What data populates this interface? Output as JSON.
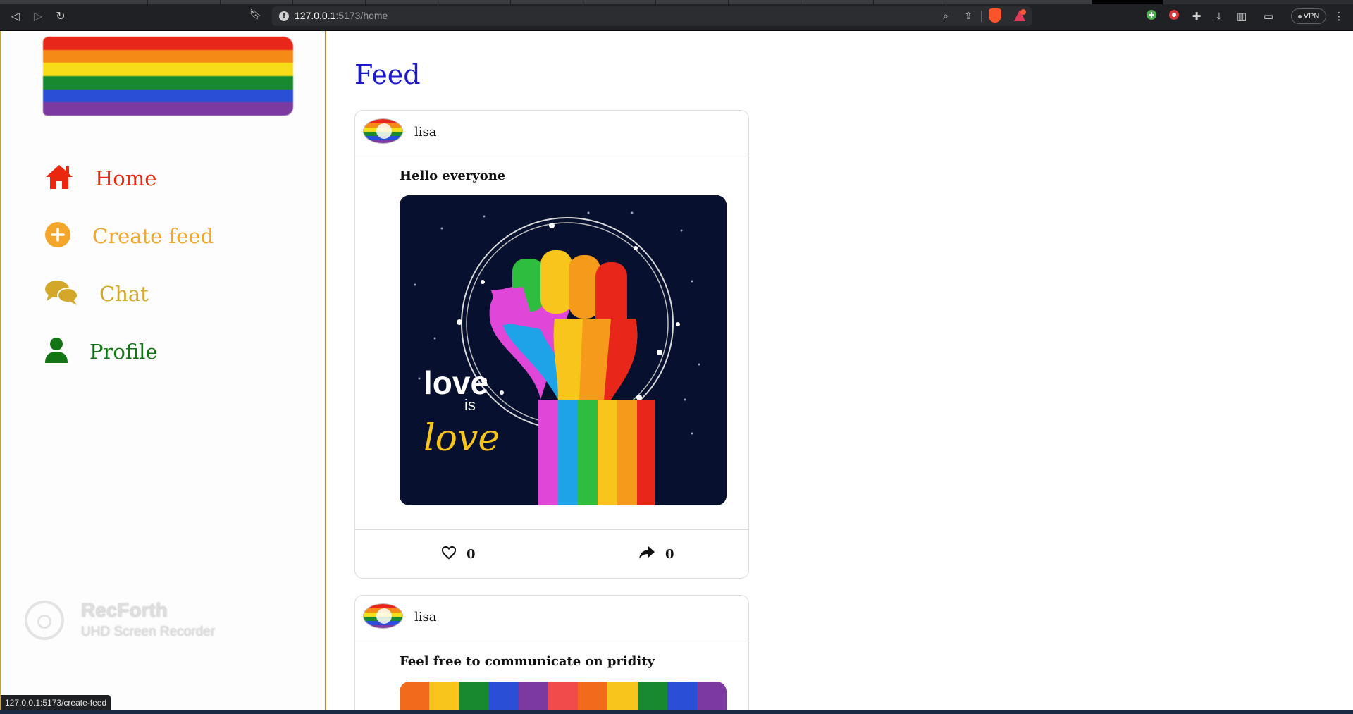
{
  "browser": {
    "url_host": "127.0.0.1",
    "url_path": ":5173/home",
    "vpn_label": "VPN",
    "status_url": "127.0.0.1:5173/create-feed"
  },
  "sidebar": {
    "nav": [
      {
        "label": "Home",
        "icon": "home-icon",
        "color": "#e8270e"
      },
      {
        "label": "Create feed",
        "icon": "plus-circle-icon",
        "color": "#f4a62a"
      },
      {
        "label": "Chat",
        "icon": "chat-bubbles-icon",
        "color": "#d3a72a"
      },
      {
        "label": "Profile",
        "icon": "user-icon",
        "color": "#137413"
      }
    ],
    "flag_colors": [
      "#e8271a",
      "#f58a17",
      "#f7dc1a",
      "#178a2f",
      "#2a4fd6",
      "#7c3aa0"
    ]
  },
  "watermark": {
    "title": "RecForth",
    "subtitle": "UHD Screen Recorder"
  },
  "main": {
    "title": "Feed",
    "title_color": "#1d1bc9",
    "posts": [
      {
        "username": "lisa",
        "caption": "Hello everyone",
        "image_text_1": "love",
        "image_text_2": "is",
        "image_text_3": "love",
        "likes": "0",
        "shares": "0"
      },
      {
        "username": "lisa",
        "caption": "Feel free to communicate on pridity"
      }
    ]
  }
}
